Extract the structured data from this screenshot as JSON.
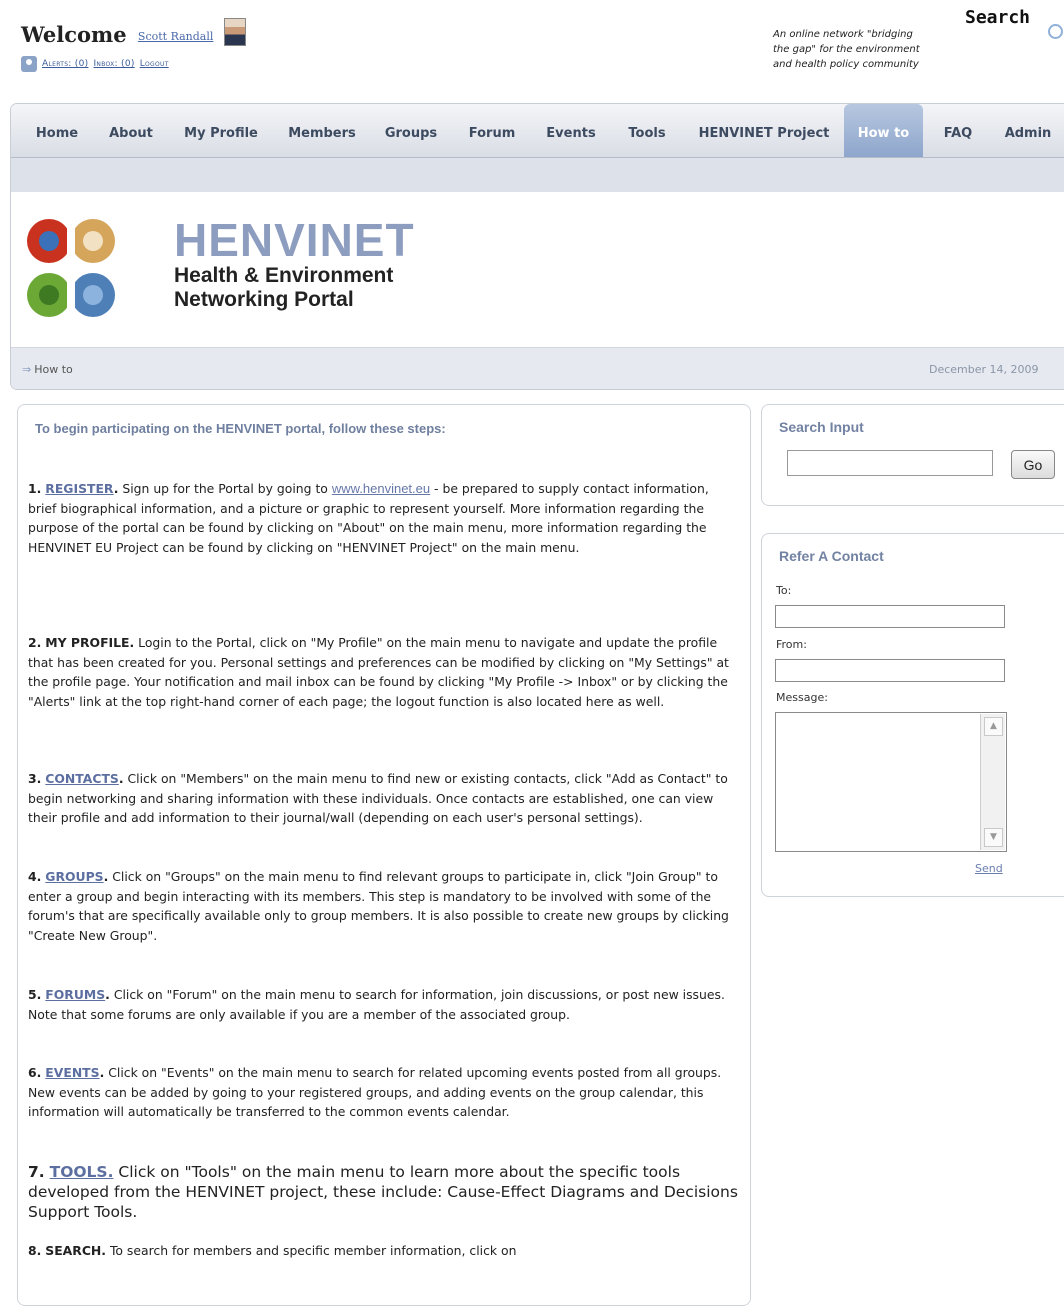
{
  "header": {
    "welcome": "Welcome",
    "user_name": "Scott Randall",
    "links": [
      "Alerts: (0)",
      "Inbox: (0)",
      "Logout"
    ],
    "tagline": [
      "An online network \"bridging",
      "the gap\" for the environment",
      "and health policy community"
    ],
    "search_title": "Search"
  },
  "menu": {
    "items": [
      "Home",
      "About",
      "My Profile",
      "Members",
      "Groups",
      "Forum",
      "Events",
      "Tools",
      "HENVINET Project",
      "How to",
      "FAQ",
      "Admin"
    ],
    "active": "How to"
  },
  "banner": {
    "title": "HENVINET",
    "subtitle_line1": "Health & Environment",
    "subtitle_line2": "Networking Portal"
  },
  "breadcrumb": {
    "current": "How to",
    "date": "December 14, 2009"
  },
  "main": {
    "intro": "To begin participating on the HENVINET portal, follow these steps:",
    "steps": [
      {
        "num": "1.",
        "label": "REGISTER",
        "text_before": " Sign up for the Portal by going to ",
        "url": "www.henvinet.eu",
        "text_after": " - be prepared to supply contact information, brief biographical information, and a picture or graphic to represent yourself. More information regarding the purpose of the portal can be found by clicking on \"About\" on the main menu, more information regarding the HENVINET EU Project can be found by clicking on \"HENVINET Project\" on the main menu."
      },
      {
        "num": "2.",
        "label": "MY PROFILE.",
        "text": " Login to the Portal, click on \"My Profile\" on the main menu to navigate and update the profile that has been created for you. Personal settings and preferences can be modified by clicking on \"My Settings\" at the profile page. Your notification and mail inbox can be found by clicking \"My Profile -> Inbox\" or by clicking the \"Alerts\" link at the top right-hand corner of each page; the logout function is also located here as well."
      },
      {
        "num": "3.",
        "label": "CONTACTS",
        "text": " Click on \"Members\" on the main menu to find new or existing contacts, click \"Add as Contact\" to begin networking and sharing information with these individuals. Once contacts are established, one can view their profile and add information to their journal/wall (depending on each user's personal settings)."
      },
      {
        "num": "4.",
        "label": "GROUPS",
        "text": " Click on \"Groups\" on the main menu to find relevant groups to participate in, click \"Join Group\" to enter a group and begin interacting with its members. This step is mandatory to be involved with some of the forum's that are specifically available only to group members. It is also possible to create new groups by clicking \"Create New Group\"."
      },
      {
        "num": "5.",
        "label": "FORUMS",
        "text": " Click on \"Forum\" on the main menu to search for information, join discussions, or post new issues. Note that some forums are only available if you are a member of the associated group."
      },
      {
        "num": "6.",
        "label": "EVENTS",
        "text": " Click on \"Events\" on the main menu to search for related upcoming events posted from all groups. New events can be added by going to your registered groups, and adding events on the group calendar, this information will automatically be transferred to the common events calendar."
      },
      {
        "num": "7.",
        "label": "TOOLS.",
        "text": " Click on \"Tools\" on the main menu to learn more about the specific tools developed from the HENVINET project, these include: Cause-Effect Diagrams and Decisions Support Tools."
      },
      {
        "num": "8.",
        "label": "SEARCH.",
        "text": " To search for members and specific member information, click on"
      }
    ]
  },
  "sidebar": {
    "search_title": "Search Input",
    "go_label": "Go",
    "refer_title": "Refer A Contact",
    "to_label": "To:",
    "from_label": "From:",
    "message_label": "Message:",
    "send_label": "Send"
  }
}
